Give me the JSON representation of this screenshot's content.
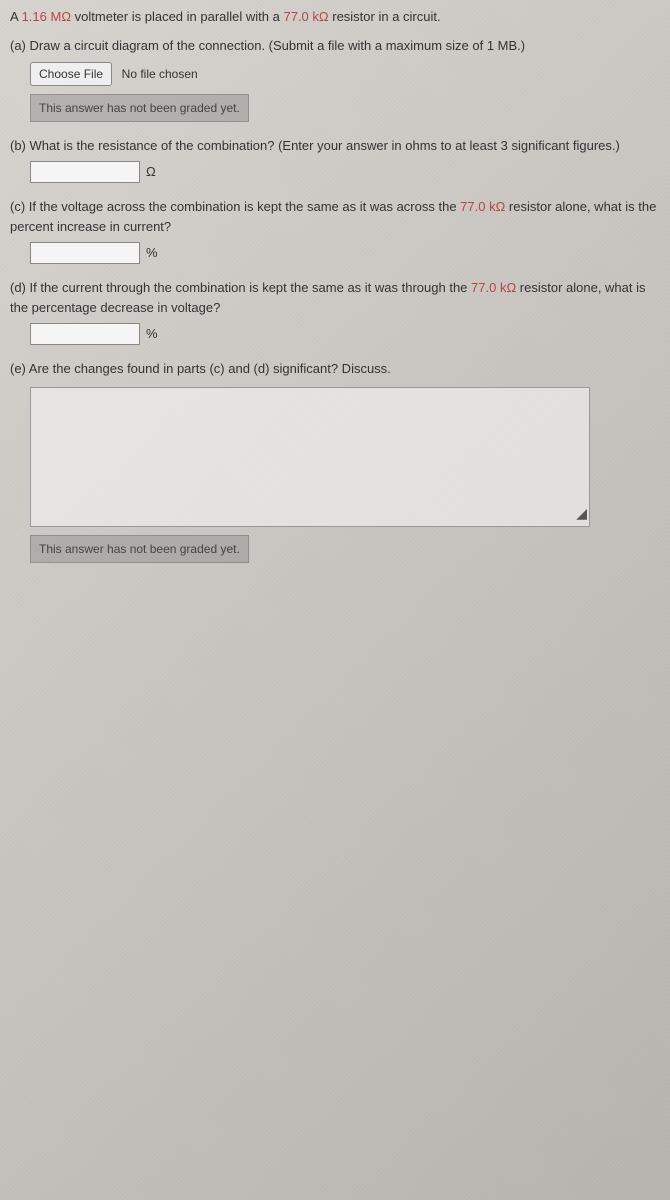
{
  "intro": {
    "prefix": "A ",
    "value1": "1.16 MΩ",
    "mid1": " voltmeter is placed in parallel with a ",
    "value2": "77.0 kΩ",
    "suffix": " resistor in a circuit."
  },
  "parts": {
    "a": {
      "label": "(a)",
      "text": " Draw a circuit diagram of the connection. (Submit a file with a maximum size of 1 MB.)",
      "fileBtn": "Choose File",
      "fileStatus": "No file chosen",
      "graded": "This answer has not been graded yet."
    },
    "b": {
      "label": "(b)",
      "text": " What is the resistance of the combination? (Enter your answer in ohms to at least 3 significant figures.)",
      "unit": "Ω"
    },
    "c": {
      "label": "(c)",
      "textPre": " If the voltage across the combination is kept the same as it was across the ",
      "value": "77.0 kΩ",
      "textPost": " resistor alone, what is the percent increase in current?",
      "unit": "%"
    },
    "d": {
      "label": "(d)",
      "textPre": " If the current through the combination is kept the same as it was through the ",
      "value": "77.0 kΩ",
      "textPost": " resistor alone, what is the percentage decrease in voltage?",
      "unit": "%"
    },
    "e": {
      "label": "(e)",
      "text": " Are the changes found in parts (c) and (d) significant? Discuss.",
      "graded": "This answer has not been graded yet."
    }
  }
}
